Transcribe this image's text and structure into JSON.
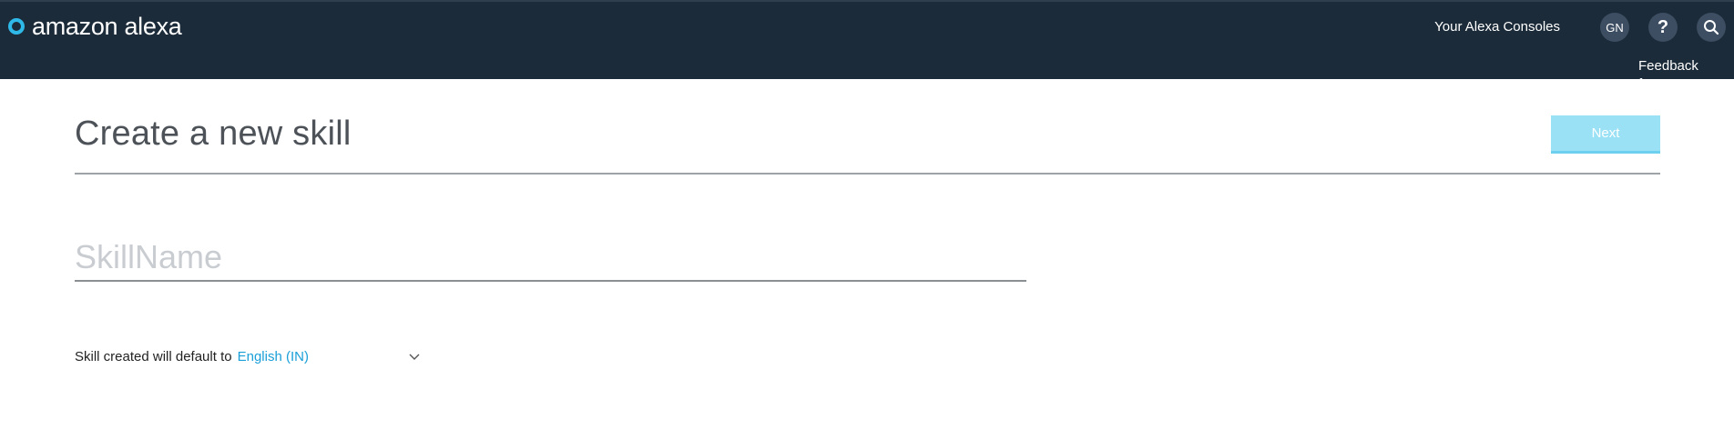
{
  "header": {
    "brand": "amazon alexa",
    "consoles_link": "Your Alexa Consoles",
    "avatar_initials": "GN",
    "help_symbol": "?",
    "feedback_link": "Feedback forum",
    "icons": [
      "alexa-logo-icon",
      "search-icon"
    ]
  },
  "page": {
    "title": "Create a new skill",
    "next_label": "Next"
  },
  "form": {
    "skill_name_placeholder": "SkillName",
    "skill_name_value": "",
    "locale_label": "Skill created will default to",
    "locale_value": "English (IN)"
  },
  "colors": {
    "header_bg": "#1c2b39",
    "accent": "#1a9fd8",
    "next_disabled": "#9ae1f6"
  }
}
